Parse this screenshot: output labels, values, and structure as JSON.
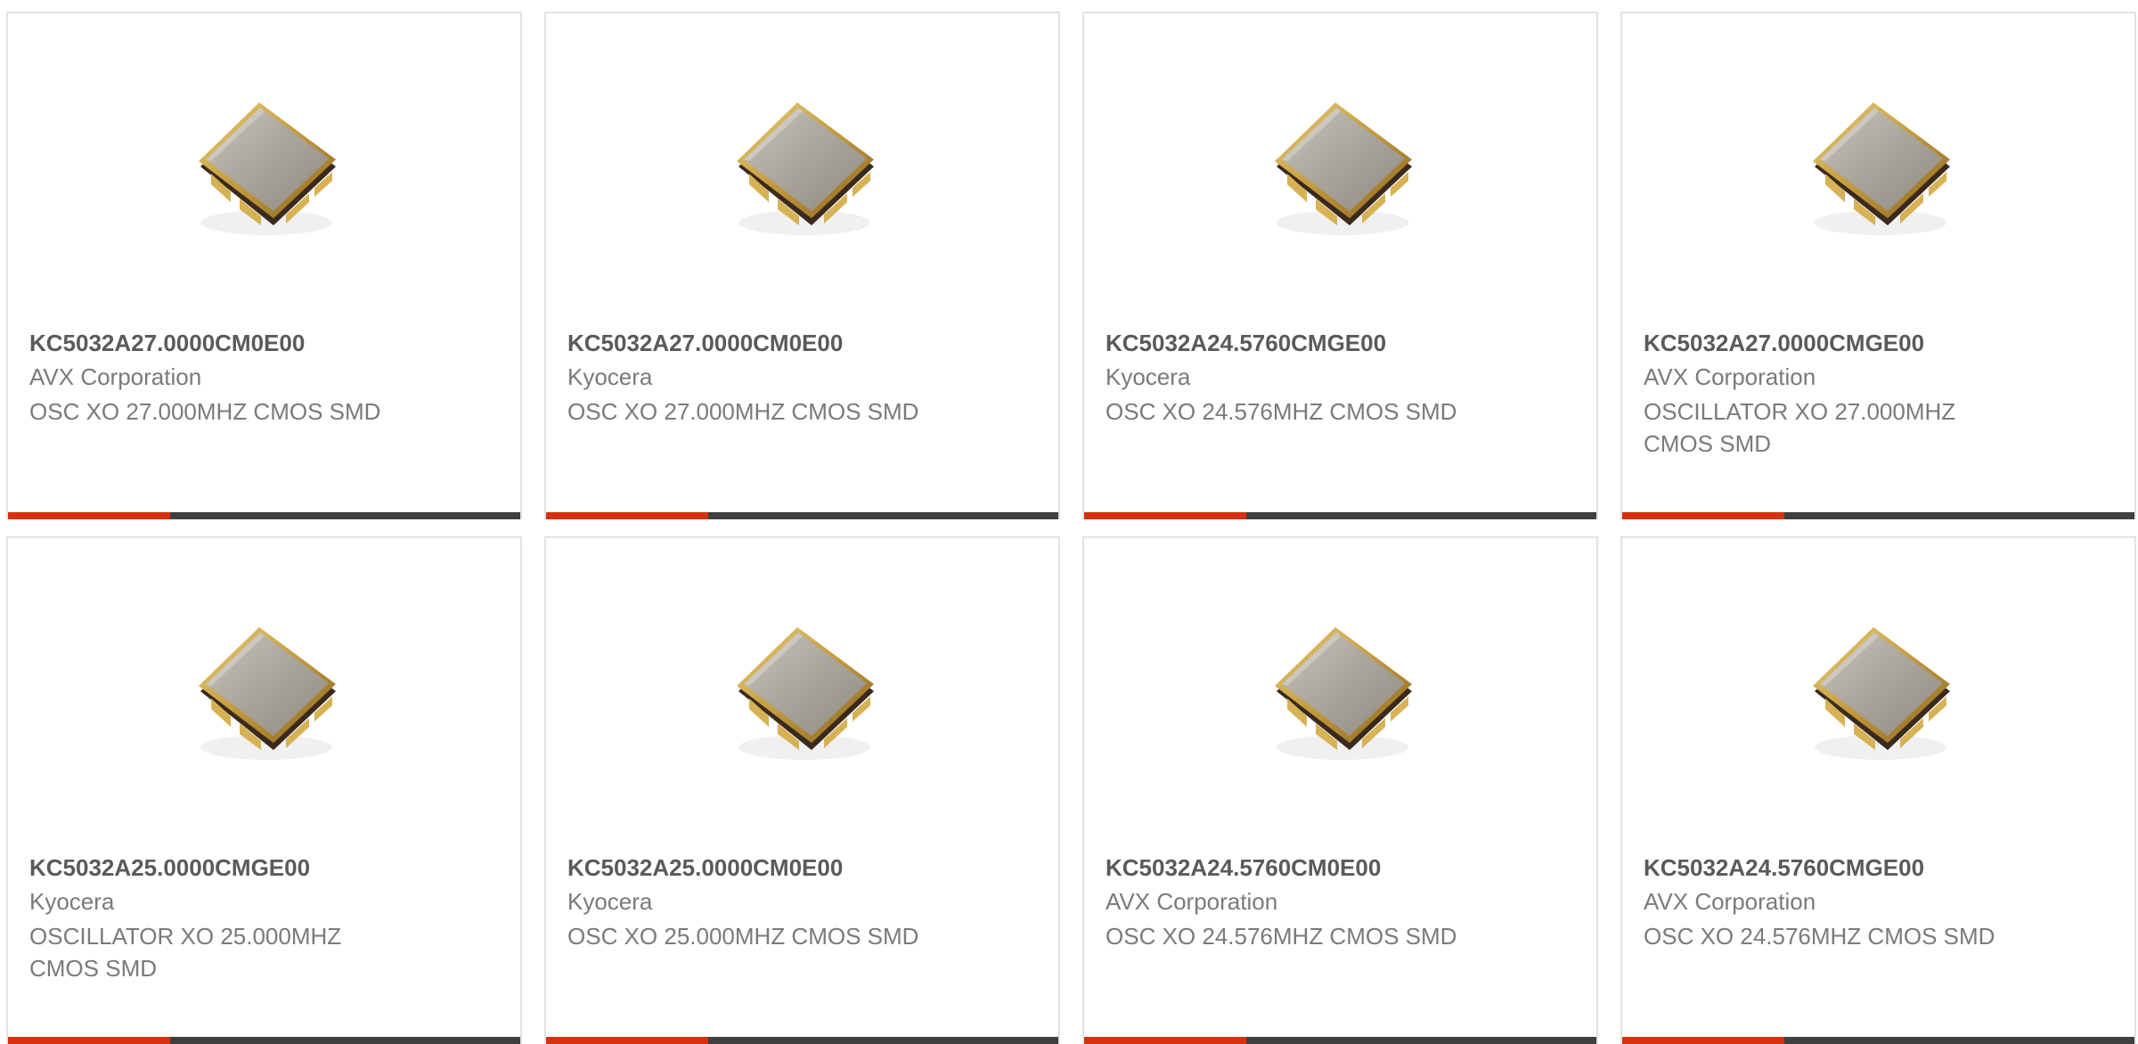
{
  "colors": {
    "accent": "#d6310e",
    "bar": "#3f3f3f",
    "part_text": "#5a5a5a",
    "meta_text": "#7a7a7a",
    "border": "#e2e2e2"
  },
  "products": [
    {
      "part": "KC5032A27.0000CM0E00",
      "manufacturer": "AVX Corporation",
      "description": "OSC XO 27.000MHZ CMOS SMD",
      "image": "oscillator-package-icon"
    },
    {
      "part": "KC5032A27.0000CM0E00",
      "manufacturer": "Kyocera",
      "description": "OSC XO 27.000MHZ CMOS SMD",
      "image": "oscillator-package-icon"
    },
    {
      "part": "KC5032A24.5760CMGE00",
      "manufacturer": "Kyocera",
      "description": "OSC XO 24.576MHZ CMOS SMD",
      "image": "oscillator-package-icon"
    },
    {
      "part": "KC5032A27.0000CMGE00",
      "manufacturer": "AVX Corporation",
      "description": "OSCILLATOR XO 27.000MHZ CMOS SMD",
      "image": "oscillator-package-icon"
    },
    {
      "part": "KC5032A25.0000CMGE00",
      "manufacturer": "Kyocera",
      "description": "OSCILLATOR XO 25.000MHZ CMOS SMD",
      "image": "oscillator-package-icon"
    },
    {
      "part": "KC5032A25.0000CM0E00",
      "manufacturer": "Kyocera",
      "description": "OSC XO 25.000MHZ CMOS SMD",
      "image": "oscillator-package-icon"
    },
    {
      "part": "KC5032A24.5760CM0E00",
      "manufacturer": "AVX Corporation",
      "description": "OSC XO 24.576MHZ CMOS SMD",
      "image": "oscillator-package-icon"
    },
    {
      "part": "KC5032A24.5760CMGE00",
      "manufacturer": "AVX Corporation",
      "description": "OSC XO 24.576MHZ CMOS SMD",
      "image": "oscillator-package-icon"
    }
  ]
}
